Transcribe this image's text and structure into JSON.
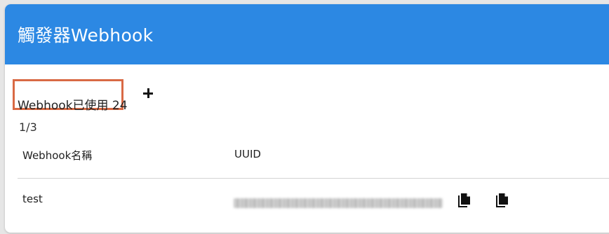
{
  "header": {
    "title": "觸發器Webhook"
  },
  "usage": {
    "label": "Webhook已使用 24"
  },
  "pagination": {
    "text": "1/3"
  },
  "table": {
    "columns": [
      "Webhook名稱",
      "UUID"
    ],
    "rows": [
      {
        "name": "test",
        "uuid": ""
      }
    ]
  },
  "icons": {
    "add": "plus-icon",
    "copy": "copy-icon"
  },
  "colors": {
    "header_bg": "#2c88e3",
    "highlight_border": "#d96a45"
  }
}
